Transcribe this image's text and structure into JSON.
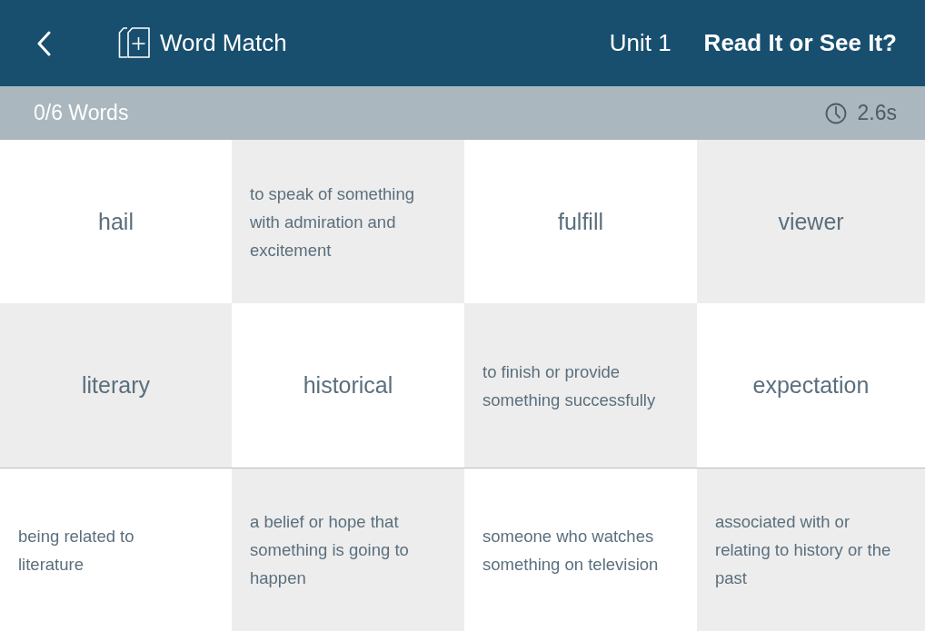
{
  "header": {
    "title": "Word Match",
    "unit": "Unit 1",
    "activity": "Read It or See It?"
  },
  "progress": {
    "count": "0/6 Words",
    "timer": "2.6s"
  },
  "rows": [
    {
      "cards": [
        {
          "kind": "word",
          "text": "hail"
        },
        {
          "kind": "definition",
          "text": "to speak of something with admiration and excitement"
        },
        {
          "kind": "word",
          "text": "fulfill"
        },
        {
          "kind": "word",
          "text": "viewer"
        }
      ]
    },
    {
      "cards": [
        {
          "kind": "word",
          "text": "literary"
        },
        {
          "kind": "word",
          "text": "historical"
        },
        {
          "kind": "definition",
          "text": "to finish or provide something successfully"
        },
        {
          "kind": "word",
          "text": "expectation"
        }
      ]
    },
    {
      "cards": [
        {
          "kind": "definition",
          "text": "being related to literature"
        },
        {
          "kind": "definition",
          "text": "a belief or hope that something is going to happen"
        },
        {
          "kind": "definition",
          "text": "someone who watches something on television"
        },
        {
          "kind": "definition",
          "text": "associated with or relating to history or the past"
        }
      ]
    }
  ]
}
